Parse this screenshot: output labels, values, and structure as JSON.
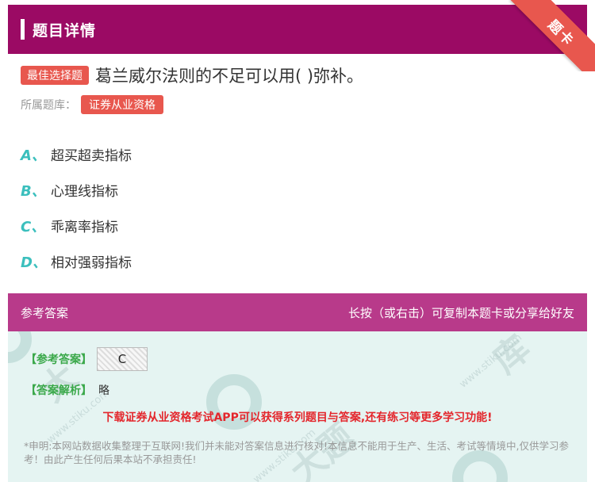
{
  "header": {
    "title": "题目详情"
  },
  "corner_badge": {
    "label": "题卡"
  },
  "question": {
    "type_tag": "最佳选择题",
    "text": "葛兰威尔法则的不足可以用( )弥补。",
    "library_label": "所属题库：",
    "library_tag": "证券从业资格"
  },
  "options": [
    {
      "letter": "A、",
      "text": "超买超卖指标"
    },
    {
      "letter": "B、",
      "text": "心理线指标"
    },
    {
      "letter": "C、",
      "text": "乖离率指标"
    },
    {
      "letter": "D、",
      "text": "相对强弱指标"
    }
  ],
  "answer_section": {
    "title": "参考答案",
    "hint": "长按（或右击）可复制本题卡或分享给好友",
    "answer_label": "【参考答案】",
    "answer_value": "C",
    "analysis_label": "【答案解析】",
    "analysis_value": "略",
    "promo": "下载证券从业资格考试APP可以获得系列题目与答案,还有练习等更多学习功能!",
    "disclaimer": "*申明:本网站数据收集整理于互联网!我们并未能对答案信息进行核对!本信息不能用于生产、生活、考试等情境中,仅供学习参考！由此产生任何后果本站不承担责任!"
  },
  "colors": {
    "header": "#9b0a64",
    "accent": "#e8574e",
    "option_letter": "#3bbfbd",
    "answer_green": "#3aa84a",
    "promo_red": "#e4262c"
  }
}
